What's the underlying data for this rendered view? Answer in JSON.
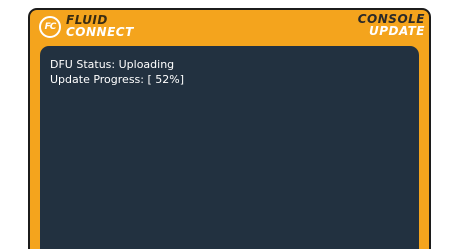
{
  "header": {
    "logo": {
      "icon": "fluid-connect-logo-icon",
      "mark_text": "FC",
      "line1": "FLUID",
      "line2": "CONNECT"
    },
    "title": {
      "line1": "CONSOLE",
      "line2": "UPDATE"
    }
  },
  "console": {
    "lines": [
      "DFU Status: Uploading",
      "Update Progress: [ 52%]"
    ],
    "progress_percent": 52
  },
  "colors": {
    "frame": "#f4a41d",
    "console_bg": "#223140",
    "text": "#ffffff"
  }
}
